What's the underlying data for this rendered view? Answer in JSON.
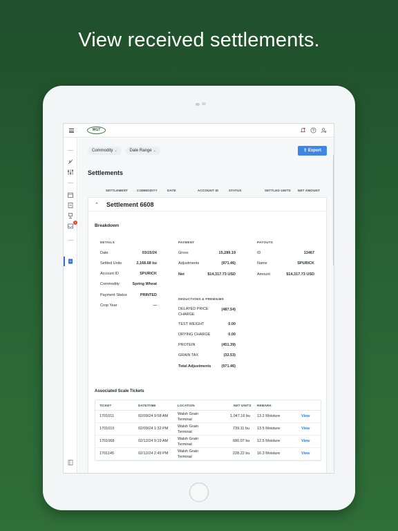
{
  "headline": "View received settlements.",
  "topbar": {
    "logo_text": "WGT"
  },
  "filters": {
    "commodity": "Commodity",
    "date_range": "Date Range"
  },
  "export_label": "Export",
  "page_title": "Settlements",
  "columns": [
    "SETTLEMENT",
    "COMMODITY",
    "DATE",
    "ACCOUNT ID",
    "STATUS",
    "SETTLED UNITS",
    "NET AMOUNT"
  ],
  "settlement": {
    "title": "Settlement 6608",
    "breakdown_label": "Breakdown",
    "details": {
      "heading": "DETAILS",
      "rows": [
        {
          "k": "Date",
          "v": "03/15/24"
        },
        {
          "k": "Settled Units",
          "v": "2,168.68 bu"
        },
        {
          "k": "Account ID",
          "v": "SPURICK"
        },
        {
          "k": "Commodity",
          "v": "Spring Wheat"
        },
        {
          "k": "Payment Status",
          "v": "PRINTED"
        },
        {
          "k": "Crop Year",
          "v": "—"
        }
      ]
    },
    "payment": {
      "heading": "PAYMENT",
      "rows": [
        {
          "k": "Gross",
          "v": "15,289.19"
        },
        {
          "k": "Adjustments",
          "v": "(971.46)"
        },
        {
          "k": "Net",
          "v": "$14,317.73 USD"
        }
      ]
    },
    "payouts": {
      "heading": "PAYOUTS",
      "rows": [
        {
          "k": "ID",
          "v": "13467"
        },
        {
          "k": "Name",
          "v": "SPURICK"
        },
        {
          "k": "Amount",
          "v": "$14,317.73 USD"
        }
      ]
    },
    "deductions": {
      "heading": "DEDUCTIONS & PREMIUMS",
      "rows": [
        {
          "k": "DELAYED PRICE CHARGE",
          "v": "(487.54)"
        },
        {
          "k": "TEST WEIGHT",
          "v": "0.00"
        },
        {
          "k": "DRYING CHARGE",
          "v": "0.00"
        },
        {
          "k": "PROTEIN",
          "v": "(451.39)"
        },
        {
          "k": "GRAIN TAX",
          "v": "(32.53)"
        },
        {
          "k": "Total Adjustments",
          "v": "(971.46)"
        }
      ]
    },
    "tickets": {
      "heading": "Associated Scale Tickets",
      "columns": [
        "TICKET",
        "DATE/TIME",
        "LOCATION",
        "NET UNITS",
        "REMARK"
      ],
      "rows": [
        {
          "ticket": "1701011",
          "datetime": "02/09/24 9:58 AM",
          "location": "Walsh Grain Terminal",
          "net": "1,047.16 bu",
          "remark": "13.2 Moisture",
          "action": "View"
        },
        {
          "ticket": "1701015",
          "datetime": "02/09/24 1:32 PM",
          "location": "Walsh Grain Terminal",
          "net": "739.11 bu",
          "remark": "13.5 Moisture",
          "action": "View"
        },
        {
          "ticket": "1701068",
          "datetime": "02/12/24 9:19 AM",
          "location": "Walsh Grain Terminal",
          "net": "680.07 bu",
          "remark": "12.5 Moisture",
          "action": "View"
        },
        {
          "ticket": "1701145",
          "datetime": "02/12/24 2:49 PM",
          "location": "Walsh Grain Terminal",
          "net": "228.22 bu",
          "remark": "16.3 Moisture",
          "action": "View"
        }
      ]
    }
  },
  "colors": {
    "accent": "#3e86e6",
    "brand_green": "#2a6635",
    "badge": "#e0462f"
  }
}
